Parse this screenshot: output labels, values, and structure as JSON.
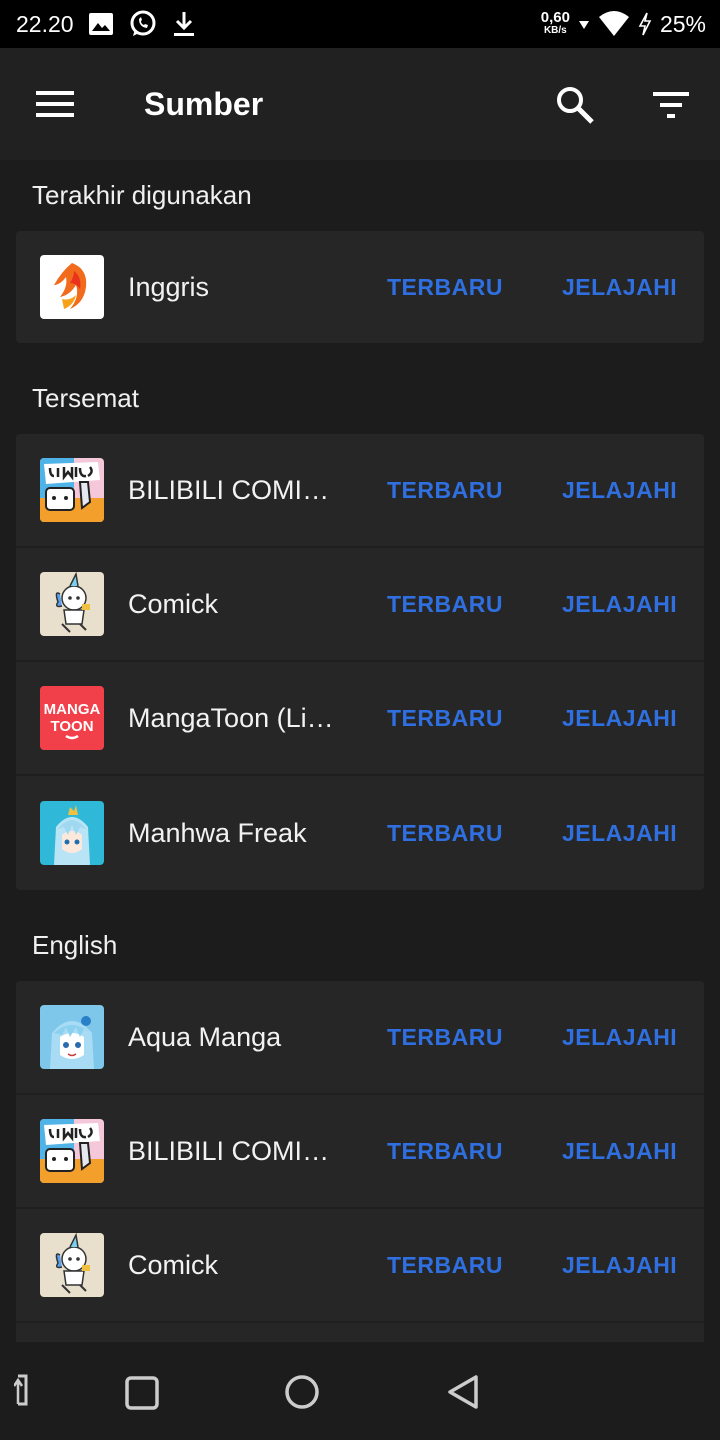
{
  "status_bar": {
    "time": "22.20",
    "speed_value": "0,60",
    "speed_unit": "KB/s",
    "battery": "25%"
  },
  "app_bar": {
    "title": "Sumber"
  },
  "sections": {
    "recent": {
      "header": "Terakhir digunakan",
      "items": [
        {
          "name": "Inggris",
          "latest": "TERBARU",
          "browse": "JELAJAHI",
          "icon": "phoenix-logo"
        }
      ]
    },
    "pinned": {
      "header": "Tersemat",
      "items": [
        {
          "name": "BILIBILI COMICS",
          "latest": "TERBARU",
          "browse": "JELAJAHI",
          "icon": "bilibili-comics-logo"
        },
        {
          "name": "Comick",
          "latest": "TERBARU",
          "browse": "JELAJAHI",
          "icon": "comick-logo"
        },
        {
          "name": "MangaToon (Li…",
          "latest": "TERBARU",
          "browse": "JELAJAHI",
          "icon": "mangatoon-logo",
          "logo_text": [
            "MANGA",
            "TOON"
          ]
        },
        {
          "name": "Manhwa Freak",
          "latest": "TERBARU",
          "browse": "JELAJAHI",
          "icon": "manhwa-freak-logo"
        }
      ]
    },
    "english": {
      "header": "English",
      "items": [
        {
          "name": "Aqua Manga",
          "latest": "TERBARU",
          "browse": "JELAJAHI",
          "icon": "aqua-manga-logo"
        },
        {
          "name": "BILIBILI COMICS",
          "latest": "TERBARU",
          "browse": "JELAJAHI",
          "icon": "bilibili-comics-logo"
        },
        {
          "name": "Comick",
          "latest": "TERBARU",
          "browse": "JELAJAHI",
          "icon": "comick-logo"
        }
      ]
    }
  },
  "colors": {
    "accent": "#2f6fe0",
    "background": "#1c1c1c",
    "card": "#262626",
    "app_bar": "#212121"
  }
}
